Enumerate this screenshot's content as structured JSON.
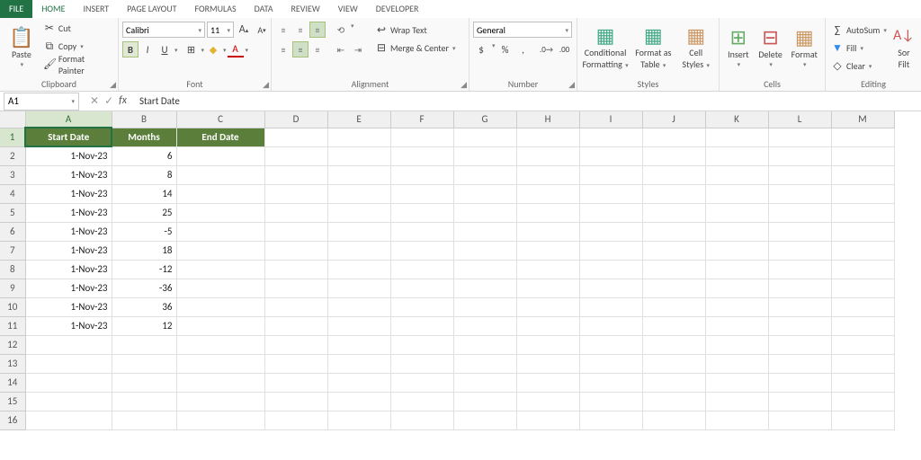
{
  "tabs": {
    "file": "FILE",
    "home": "HOME",
    "insert": "INSERT",
    "page_layout": "PAGE LAYOUT",
    "formulas": "FORMULAS",
    "data": "DATA",
    "review": "REVIEW",
    "view": "VIEW",
    "developer": "DEVELOPER"
  },
  "ribbon": {
    "clipboard": {
      "paste": "Paste",
      "cut": "Cut",
      "copy": "Copy",
      "format_painter": "Format Painter",
      "label": "Clipboard"
    },
    "font": {
      "name": "Calibri",
      "size": "11",
      "grow": "A",
      "shrink": "A",
      "bold": "B",
      "italic": "I",
      "underline": "U",
      "label": "Font"
    },
    "alignment": {
      "wrap": "Wrap Text",
      "merge": "Merge & Center",
      "label": "Alignment"
    },
    "number": {
      "format": "General",
      "label": "Number"
    },
    "styles": {
      "cond": "Conditional",
      "cond2": "Formatting",
      "table": "Format as",
      "table2": "Table",
      "cell": "Cell",
      "cell2": "Styles",
      "label": "Styles"
    },
    "cells": {
      "insert": "Insert",
      "delete": "Delete",
      "format": "Format",
      "label": "Cells"
    },
    "editing": {
      "autosum": "AutoSum",
      "fill": "Fill",
      "clear": "Clear",
      "sort": "Sor",
      "filt": "Filt",
      "label": "Editing"
    }
  },
  "namebox": "A1",
  "formula_value": "Start Date",
  "columns": [
    "A",
    "B",
    "C",
    "D",
    "E",
    "F",
    "G",
    "H",
    "I",
    "J",
    "K",
    "L",
    "M"
  ],
  "headers": {
    "A": "Start Date",
    "B": "Months",
    "C": "End Date"
  },
  "rows": [
    {
      "A": "1-Nov-23",
      "B": "6",
      "C": ""
    },
    {
      "A": "1-Nov-23",
      "B": "8",
      "C": ""
    },
    {
      "A": "1-Nov-23",
      "B": "14",
      "C": ""
    },
    {
      "A": "1-Nov-23",
      "B": "25",
      "C": ""
    },
    {
      "A": "1-Nov-23",
      "B": "-5",
      "C": ""
    },
    {
      "A": "1-Nov-23",
      "B": "18",
      "C": ""
    },
    {
      "A": "1-Nov-23",
      "B": "-12",
      "C": ""
    },
    {
      "A": "1-Nov-23",
      "B": "-36",
      "C": ""
    },
    {
      "A": "1-Nov-23",
      "B": "36",
      "C": ""
    },
    {
      "A": "1-Nov-23",
      "B": "12",
      "C": ""
    }
  ],
  "selected_cell": "A1"
}
